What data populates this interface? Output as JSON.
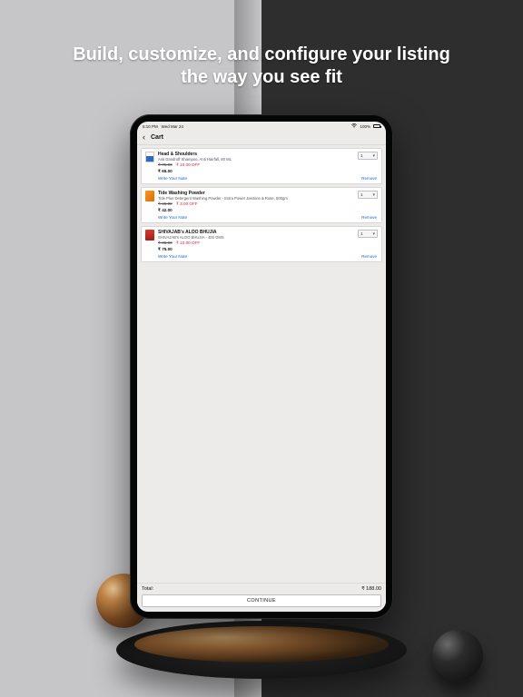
{
  "marketing": {
    "headline_line1": "Build, customize, and configure your listing",
    "headline_line2": "the way you see fit"
  },
  "statusbar": {
    "time": "6:10 PM",
    "date": "Wed Mar 24",
    "wifi_icon": "wifi-icon",
    "battery_pct": "100%"
  },
  "nav": {
    "back_glyph": "‹",
    "title": "Cart"
  },
  "cart": {
    "items": [
      {
        "name": "Head & Shoulders",
        "desc": "Anti Dandruff Shampoo, Anti Hairfall, 80 ML",
        "original": "₹ 75.00",
        "off": "₹ 10.00 OFF",
        "price": "₹ 65.00",
        "note": "Write Your Note",
        "remove": "Remove",
        "qty": "1"
      },
      {
        "name": "Tide Washing Powder",
        "desc": "Tide Plus Detergent Washing Powder - Extra Power Jasmine & Rose, 500gm",
        "original": "₹ 45.00",
        "off": "₹ 3.00 OFF",
        "price": "₹ 42.00",
        "note": "Write Your Note",
        "remove": "Remove",
        "qty": "1"
      },
      {
        "name": "SHIVAJAB's ALOO BHUJIA",
        "desc": "SHIVAJAB's ALOO BHUJIA - 400 GMS",
        "original": "₹ 85.00",
        "off": "₹ 10.00 OFF",
        "price": "₹ 75.00",
        "note": "Write Your Note",
        "remove": "Remove",
        "qty": "1"
      }
    ]
  },
  "footer": {
    "total_label": "Total:",
    "total_value": "₹ 188.00",
    "continue": "CONTINUE"
  },
  "qty_caret": "▾"
}
